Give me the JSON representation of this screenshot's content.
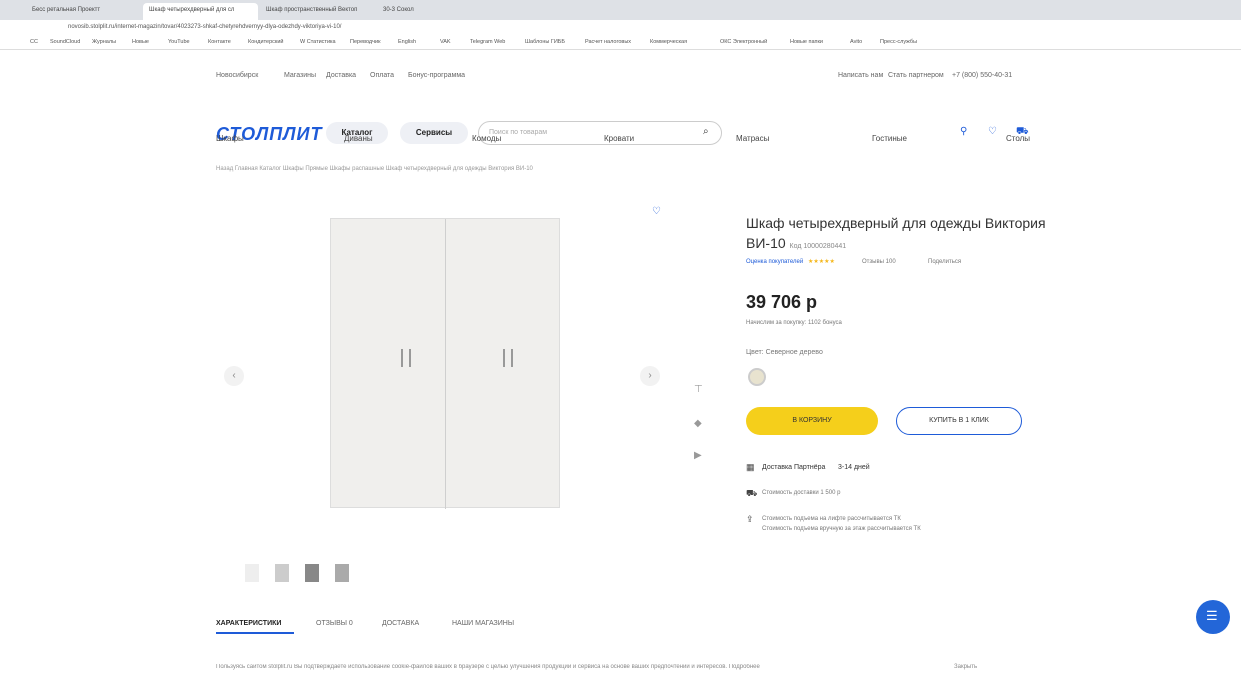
{
  "browser": {
    "tabs": [
      "Бесс ретальная Проектт",
      "Шкаф четырехдверный для сл",
      "Шкаф пространственный Вектоп",
      "30-3 Сокол"
    ],
    "url": "novosib.stolplit.ru/internet-magazin/tovar/4023273-shkaf-chetyrehdvernyy-dlya-odezhdy-viktoriya-vi-10/",
    "bookmarks": [
      "СС",
      "SoundCloud",
      "Журналы",
      "Новые",
      "YouTube",
      "Контакте",
      "Кондитерский",
      "W Статистика",
      "Переводчик",
      "English",
      "VAK",
      "Telegram Web",
      "Шаблоны ГИББ",
      "Расчет налоговых",
      "Коммерческая",
      "ОКС Электронный",
      "Новые папки",
      "Avito",
      "Пресс-службы"
    ]
  },
  "site": {
    "city": "Новосибирск",
    "top_links": [
      "Магазины",
      "Доставка",
      "Оплата",
      "Бонус-программа"
    ],
    "top_right": [
      "Написать нам",
      "Стать партнером",
      "+7 (800) 550-40-31"
    ],
    "brand": "СТОЛПЛИТ",
    "catalog": "Каталог",
    "services": "Сервисы",
    "search_placeholder": "Поиск по товарам",
    "nav": [
      "Шкафы",
      "Диваны",
      "Комоды",
      "Кровати",
      "Матрасы",
      "Гостиные",
      "Столы"
    ]
  },
  "breadcrumbs": "Назад Главная Каталог Шкафы Прямые Шкафы распашные Шкаф четырехдверный для одежды Виктория ВИ-10",
  "product": {
    "title": "Шкаф четырехдверный для одежды Виктория ВИ-10",
    "code": "Код 10000280441",
    "rating_text": "Оценка покупателей",
    "reviews": "Отзывы 100",
    "share": "Поделиться",
    "price": "39 706 р",
    "bonus": "Начислим за покупку: 1102 бонуса",
    "color_label": "Цвет: Северное дерево",
    "cart": "В КОРЗИНУ",
    "one_click": "КУПИТЬ В 1 КЛИК",
    "delivery": "Доставка Партнёра",
    "delivery_days": "3-14 дней",
    "assembly": "Стоимость доставки 1 500 р",
    "lift1": "Стоимость подъема на лифте рассчитывается ТК",
    "lift2": "Стоимость подъема вручную за этаж рассчитывается ТК"
  },
  "tabs": [
    "ХАРАКТЕРИСТИКИ",
    "ОТЗЫВЫ 0",
    "ДОСТАВКА",
    "НАШИ МАГАЗИНЫ"
  ],
  "cookie": {
    "text": "Пользуясь сайтом stolplit.ru Вы подтверждаете использование cookie-файлов ваших в браузере с целью улучшения продукции и сервиса на основе ваших предпочтений и интересов. Подробнее",
    "close": "Закрыть"
  },
  "colors": {
    "accent": "#1e5bd8",
    "cart": "#f5cf1b"
  }
}
